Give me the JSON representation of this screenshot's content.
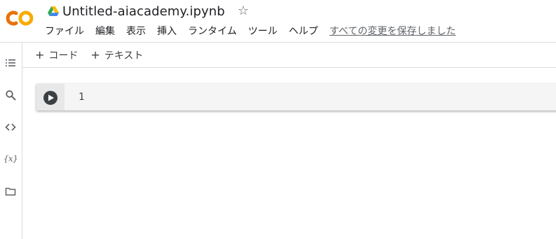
{
  "notebook": {
    "title": "Untitled-aiacademy.ipynb"
  },
  "menu": {
    "items": [
      {
        "label": "ファイル"
      },
      {
        "label": "編集"
      },
      {
        "label": "表示"
      },
      {
        "label": "挿入"
      },
      {
        "label": "ランタイム"
      },
      {
        "label": "ツール"
      },
      {
        "label": "ヘルプ"
      }
    ],
    "save_status": "すべての変更を保存しました"
  },
  "toolbar": {
    "add_code": "コード",
    "add_text": "テキスト",
    "plus": "+"
  },
  "sidebar": {
    "icons": [
      "table-of-contents-icon",
      "search-icon",
      "code-snippets-icon",
      "variables-icon",
      "folder-icon"
    ],
    "variables_label": "{x}"
  },
  "cell": {
    "line_number": "1"
  },
  "colors": {
    "logo_orange": "#F9AB00",
    "logo_dark_orange": "#E8710A",
    "run_button": "#3c4043",
    "cell_background": "#f5f5f5"
  }
}
